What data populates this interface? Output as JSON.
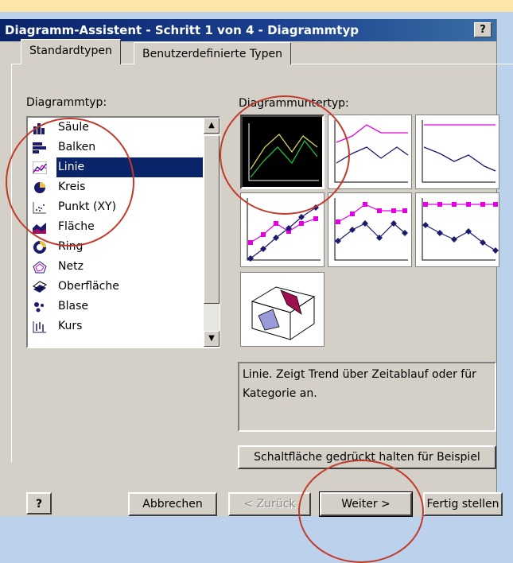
{
  "window": {
    "title": "Diagramm-Assistent - Schritt 1 von 4 - Diagrammtyp",
    "help": "?"
  },
  "tabs": [
    {
      "label": "Standardtypen"
    },
    {
      "label": "Benutzerdefinierte Typen"
    }
  ],
  "chart_type_label": "Diagrammtyp:",
  "chart_types": [
    {
      "label": "Säule",
      "icon": "column-chart-icon"
    },
    {
      "label": "Balken",
      "icon": "bar-chart-icon"
    },
    {
      "label": "Linie",
      "icon": "line-chart-icon",
      "selected": true
    },
    {
      "label": "Kreis",
      "icon": "pie-chart-icon"
    },
    {
      "label": "Punkt (XY)",
      "icon": "scatter-chart-icon"
    },
    {
      "label": "Fläche",
      "icon": "area-chart-icon"
    },
    {
      "label": "Ring",
      "icon": "doughnut-chart-icon"
    },
    {
      "label": "Netz",
      "icon": "radar-chart-icon"
    },
    {
      "label": "Oberfläche",
      "icon": "surface-chart-icon"
    },
    {
      "label": "Blase",
      "icon": "bubble-chart-icon"
    },
    {
      "label": "Kurs",
      "icon": "stock-chart-icon"
    }
  ],
  "subtype_label": "Diagrammuntertyp:",
  "description": "Linie. Zeigt Trend über Zeitablauf oder für Kategorie an.",
  "preview_button": "Schaltfläche gedrückt halten für Beispiel",
  "footer": {
    "cancel": "Abbrechen",
    "back": "< Zurück",
    "next": "Weiter >",
    "finish": "Fertig stellen"
  },
  "colors": {
    "title_bar": "#0a246a",
    "selection": "#0a246a",
    "annotation": "#c23a2a",
    "accent_magenta": "#e000e0",
    "accent_navy": "#1a1a6e"
  }
}
